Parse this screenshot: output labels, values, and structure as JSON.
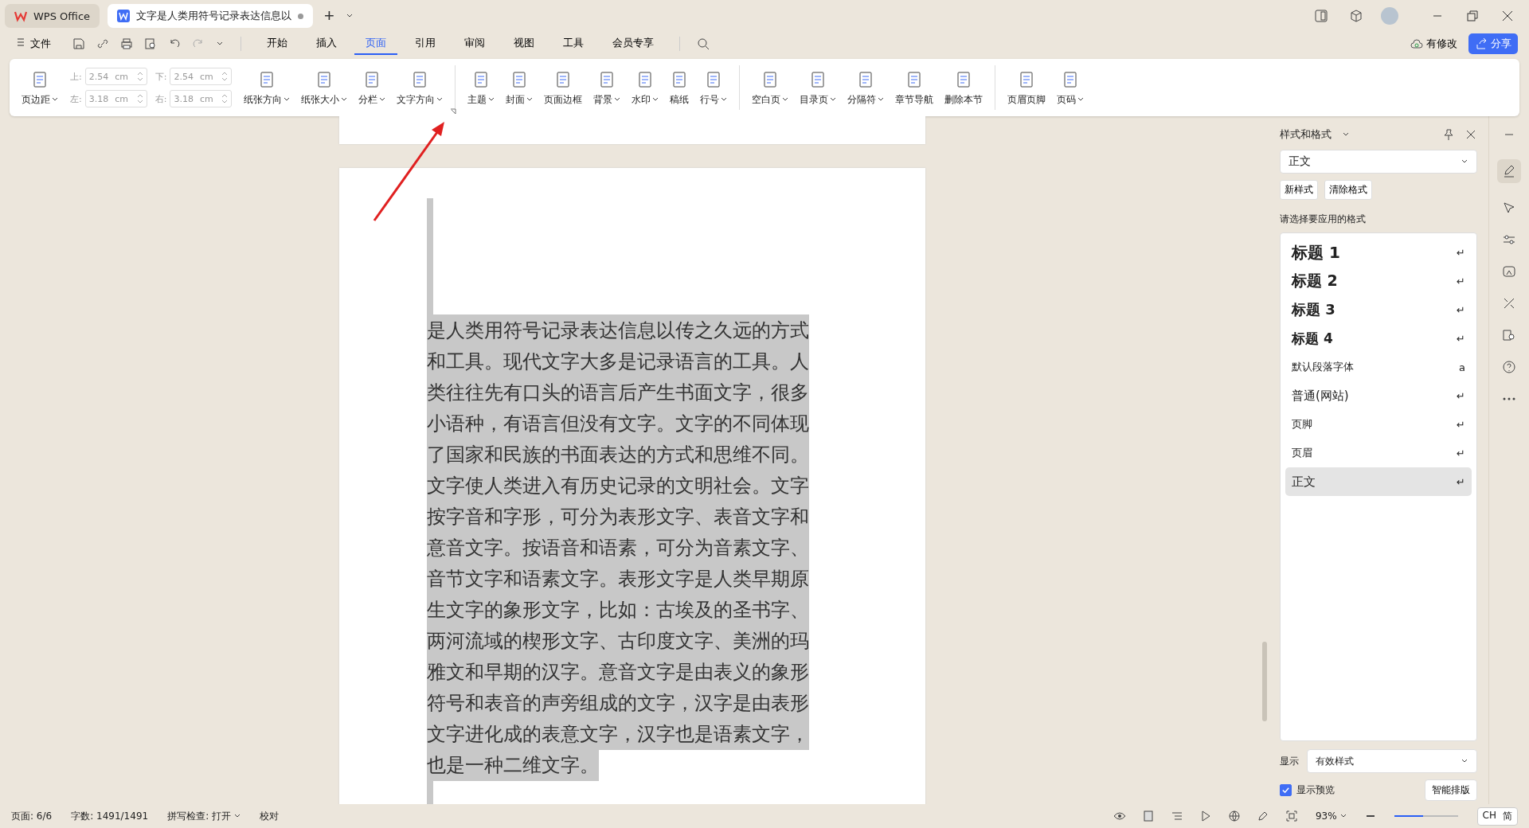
{
  "title_bar": {
    "tabs": [
      {
        "label": "WPS Office",
        "kind": "home",
        "selected": false,
        "unsaved": false
      },
      {
        "label": "文字是人类用符号记录表达信息以",
        "kind": "document",
        "selected": true,
        "unsaved": true
      }
    ],
    "new_tab": "+"
  },
  "menu": {
    "file": "文件",
    "tabs": [
      {
        "label": "开始",
        "selected": false
      },
      {
        "label": "插入",
        "selected": false
      },
      {
        "label": "页面",
        "selected": true
      },
      {
        "label": "引用",
        "selected": false
      },
      {
        "label": "审阅",
        "selected": false
      },
      {
        "label": "视图",
        "selected": false
      },
      {
        "label": "工具",
        "selected": false
      },
      {
        "label": "会员专享",
        "selected": false
      }
    ],
    "status": "有修改",
    "share": "分享"
  },
  "ribbon": {
    "groups": [
      [
        {
          "kind": "button",
          "label": "页边距",
          "dropdown": true
        },
        {
          "kind": "margins",
          "fields": [
            {
              "label": "上:",
              "value": "2.54",
              "unit": "cm"
            },
            {
              "label": "下:",
              "value": "2.54",
              "unit": "cm"
            },
            {
              "label": "左:",
              "value": "3.18",
              "unit": "cm"
            },
            {
              "label": "右:",
              "value": "3.18",
              "unit": "cm"
            }
          ]
        },
        {
          "kind": "button",
          "label": "纸张方向",
          "dropdown": true
        },
        {
          "kind": "button",
          "label": "纸张大小",
          "dropdown": true
        },
        {
          "kind": "button",
          "label": "分栏",
          "dropdown": true
        },
        {
          "kind": "button",
          "label": "文字方向",
          "dropdown": true
        }
      ],
      [
        {
          "kind": "button",
          "label": "主题",
          "dropdown": true
        },
        {
          "kind": "button",
          "label": "封面",
          "dropdown": true
        },
        {
          "kind": "button",
          "label": "页面边框",
          "dropdown": false
        },
        {
          "kind": "button",
          "label": "背景",
          "dropdown": true
        },
        {
          "kind": "button",
          "label": "水印",
          "dropdown": true
        },
        {
          "kind": "button",
          "label": "稿纸",
          "dropdown": false
        },
        {
          "kind": "button",
          "label": "行号",
          "dropdown": true
        }
      ],
      [
        {
          "kind": "button",
          "label": "空白页",
          "dropdown": true
        },
        {
          "kind": "button",
          "label": "目录页",
          "dropdown": true
        },
        {
          "kind": "button",
          "label": "分隔符",
          "dropdown": true
        },
        {
          "kind": "button",
          "label": "章节导航",
          "dropdown": false
        },
        {
          "kind": "button",
          "label": "删除本节",
          "dropdown": false
        }
      ],
      [
        {
          "kind": "button",
          "label": "页眉页脚",
          "dropdown": false
        },
        {
          "kind": "button",
          "label": "页码",
          "dropdown": true
        }
      ]
    ]
  },
  "document": {
    "paragraph": "是人类用符号记录表达信息以传之久远的方式和工具。现代文字大多是记录语言的工具。人类往往先有口头的语言后产生书面文字，很多小语种，有语言但没有文字。文字的不同体现了国家和民族的书面表达的方式和思维不同。文字使人类进入有历史记录的文明社会。文字按字音和字形，可分为表形文字、表音文字和意音文字。按语音和语素，可分为音素文字、音节文字和语素文字。表形文字是人类早期原生文字的象形文字，比如：古埃及的圣书字、两河流域的楔形文字、古印度文字、美洲的玛雅文和早期的汉字。意音文字是由表义的象形符号和表音的声旁组成的文字，汉字是由表形文字进化成的表意文字，汉字也是语素文字，也是一种二维文字。"
  },
  "styles_panel": {
    "title": "样式和格式",
    "current": "正文",
    "buttons": [
      "新样式",
      "清除格式"
    ],
    "hint": "请选择要应用的格式",
    "styles": [
      {
        "name": "标题 1",
        "kind": "heading1",
        "mark": "↵",
        "selected": false
      },
      {
        "name": "标题 2",
        "kind": "heading2",
        "mark": "↵",
        "selected": false
      },
      {
        "name": "标题 3",
        "kind": "heading3",
        "mark": "↵",
        "selected": false
      },
      {
        "name": "标题 4",
        "kind": "heading4",
        "mark": "↵",
        "selected": false
      },
      {
        "name": "默认段落字体",
        "kind": "small",
        "mark": "a",
        "selected": false
      },
      {
        "name": "普通(网站)",
        "kind": "normal",
        "mark": "↵",
        "selected": false
      },
      {
        "name": "页脚",
        "kind": "small",
        "mark": "↵",
        "selected": false
      },
      {
        "name": "页眉",
        "kind": "small",
        "mark": "↵",
        "selected": false
      },
      {
        "name": "正文",
        "kind": "normal",
        "mark": "↵",
        "selected": true
      }
    ],
    "show_label": "显示",
    "show_value": "有效样式",
    "preview": {
      "label": "显示预览",
      "checked": true
    },
    "smart_button": "智能排版"
  },
  "status_bar": {
    "page": "页面: 6/6",
    "words": "字数: 1491/1491",
    "spell": "拼写检查: 打开",
    "proof": "校对",
    "zoom": "93%",
    "zoom_slider": {
      "level": 0.45
    },
    "ime": [
      "CH",
      "简"
    ]
  }
}
